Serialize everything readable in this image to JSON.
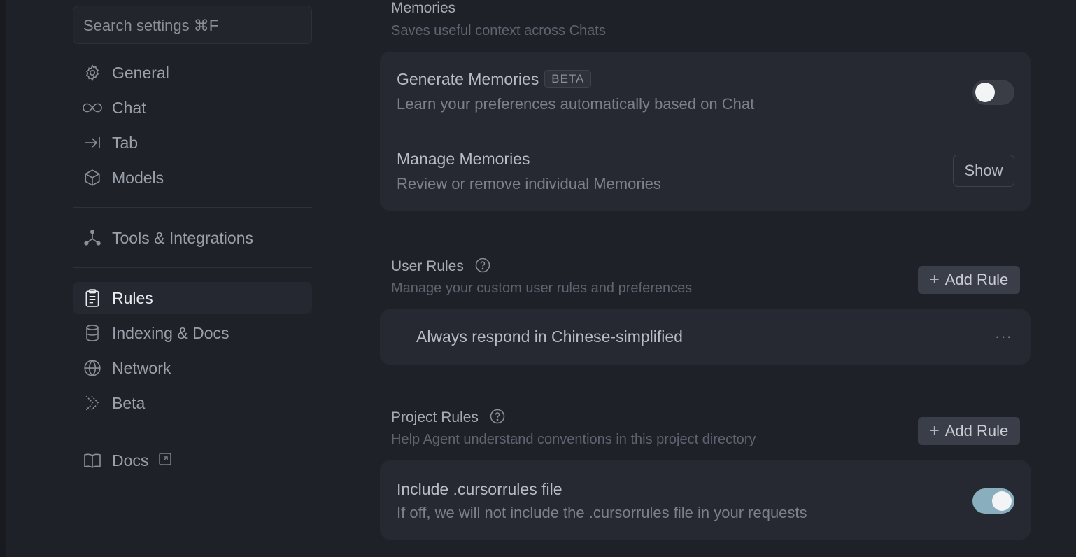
{
  "sidebar": {
    "search_placeholder": "Search settings ⌘F",
    "items": [
      {
        "label": "General",
        "icon": "gear-icon"
      },
      {
        "label": "Chat",
        "icon": "infinity-icon"
      },
      {
        "label": "Tab",
        "icon": "tab-arrow-icon"
      },
      {
        "label": "Models",
        "icon": "cube-icon"
      },
      {
        "label": "Tools & Integrations",
        "icon": "network-nodes-icon"
      },
      {
        "label": "Rules",
        "icon": "clipboard-icon",
        "active": true
      },
      {
        "label": "Indexing & Docs",
        "icon": "database-icon"
      },
      {
        "label": "Network",
        "icon": "globe-icon"
      },
      {
        "label": "Beta",
        "icon": "chevrons-icon"
      },
      {
        "label": "Docs",
        "icon": "book-icon"
      }
    ]
  },
  "memories": {
    "title": "Memories",
    "subtitle": "Saves useful context across Chats",
    "generate": {
      "title": "Generate Memories",
      "badge": "BETA",
      "subtitle": "Learn your preferences automatically based on Chat",
      "enabled": false
    },
    "manage": {
      "title": "Manage Memories",
      "subtitle": "Review or remove individual Memories",
      "button": "Show"
    }
  },
  "user_rules": {
    "title": "User Rules",
    "subtitle": "Manage your custom user rules and preferences",
    "add_label": "Add Rule",
    "rules": [
      "Always respond in Chinese-simplified"
    ],
    "more_label": "···"
  },
  "project_rules": {
    "title": "Project Rules",
    "subtitle": "Help Agent understand conventions in this project directory",
    "add_label": "Add Rule",
    "cursorrules": {
      "title": "Include .cursorrules file",
      "subtitle": "If off, we will not include the .cursorrules file in your requests",
      "enabled": true
    }
  },
  "colors": {
    "background": "#1f2128",
    "card": "#262931",
    "toggle_on": "#89aebd"
  }
}
